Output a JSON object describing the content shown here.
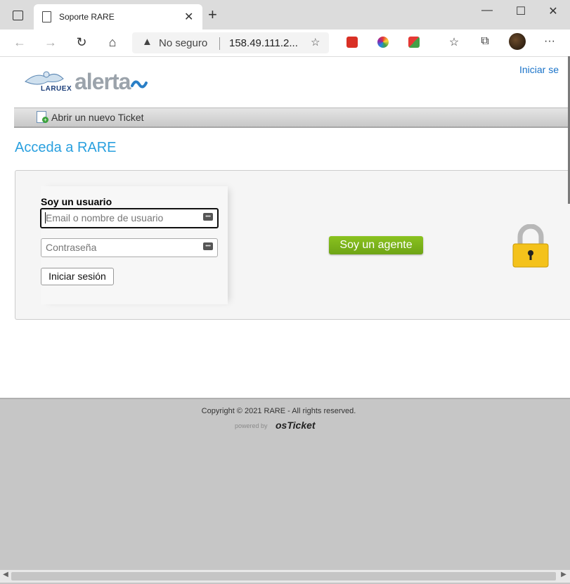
{
  "browser": {
    "tab_title": "Soporte RARE",
    "tab_close": "✕",
    "new_tab": "+",
    "window_minimize": "—",
    "window_maximize": "☐",
    "window_close": "✕",
    "back": "←",
    "forward": "→",
    "reload": "↻",
    "home": "⌂",
    "security_warning_icon": "▲",
    "security_label": "No seguro",
    "url": "158.49.111.2...",
    "favorite_add": "☆",
    "favorites": "☆",
    "collections": "⧉",
    "more": "···"
  },
  "header": {
    "signin_link": "Iniciar se",
    "logo_laruex": "LARUEX",
    "logo_alerta": "alerta",
    "logo_wave": "~"
  },
  "navbar": {
    "new_ticket": "Abrir un nuevo Ticket"
  },
  "page": {
    "title": "Acceda a RARE",
    "user_heading": "Soy un usuario",
    "username_placeholder": "Email o nombre de usuario",
    "password_placeholder": "Contraseña",
    "login_button": "Iniciar sesión",
    "agent_button": "Soy un agente"
  },
  "footer": {
    "copyright": "Copyright © 2021 RARE - All rights reserved.",
    "powered_by": "powered by",
    "osticket": "osTicket"
  },
  "colors": {
    "accent": "#2aa0df",
    "agent_button": "#7ab51b",
    "link": "#1a73c9"
  }
}
